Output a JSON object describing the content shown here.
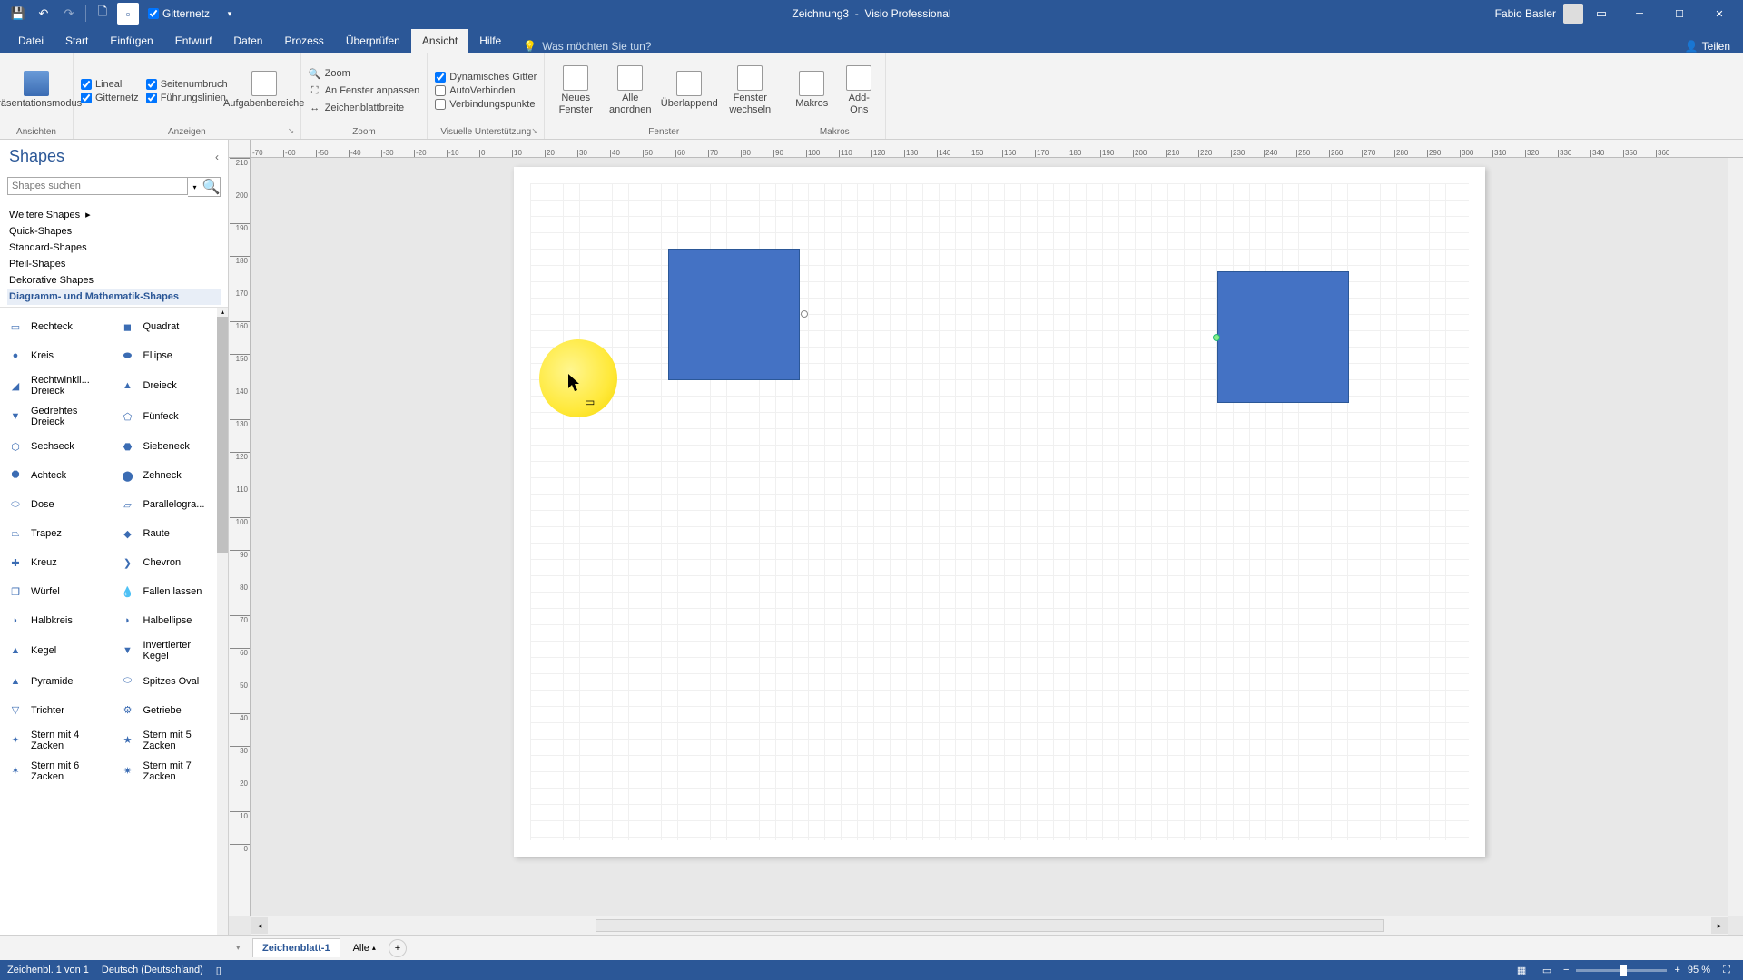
{
  "app": {
    "doc_title": "Zeichnung3",
    "app_name": "Visio Professional",
    "user_name": "Fabio Basler",
    "qat_check_label": "Gitternetz",
    "share_label": "Teilen"
  },
  "tabs": {
    "datei": "Datei",
    "start": "Start",
    "einfuegen": "Einfügen",
    "entwurf": "Entwurf",
    "daten": "Daten",
    "prozess": "Prozess",
    "ueberpruefen": "Überprüfen",
    "ansicht": "Ansicht",
    "hilfe": "Hilfe",
    "tellme": "Was möchten Sie tun?"
  },
  "ribbon": {
    "ansichten": {
      "label": "Ansichten",
      "praesentationsmodus": "Präsentationsmodus"
    },
    "anzeigen": {
      "label": "Anzeigen",
      "lineal": "Lineal",
      "gitternetz": "Gitternetz",
      "seitenumbruch": "Seitenumbruch",
      "fuehrungslinien": "Führungslinien",
      "aufgabenbereiche": "Aufgabenbereiche"
    },
    "zoom": {
      "label": "Zoom",
      "zoom": "Zoom",
      "fenster_anpassen": "An Fenster anpassen",
      "zeichenblattbreite": "Zeichenblattbreite"
    },
    "visuelle": {
      "label": "Visuelle Unterstützung",
      "dynamisches_gitter": "Dynamisches Gitter",
      "autoverbinden": "AutoVerbinden",
      "verbindungspunkte": "Verbindungspunkte"
    },
    "fenster": {
      "label": "Fenster",
      "neues_fenster": "Neues\nFenster",
      "alle_anordnen": "Alle\nanordnen",
      "ueberlappend": "Überlappend",
      "fenster_wechseln": "Fenster\nwechseln"
    },
    "makros": {
      "label": "Makros",
      "makros": "Makros",
      "addons": "Add-\nOns"
    }
  },
  "shapes_panel": {
    "title": "Shapes",
    "search_placeholder": "Shapes suchen",
    "stencils": {
      "weitere": "Weitere Shapes",
      "quick": "Quick-Shapes",
      "standard": "Standard-Shapes",
      "pfeil": "Pfeil-Shapes",
      "dekorative": "Dekorative Shapes",
      "diagramm": "Diagramm- und Mathematik-Shapes"
    },
    "shapes": [
      {
        "label": "Rechteck",
        "icon": "rect"
      },
      {
        "label": "Quadrat",
        "icon": "square"
      },
      {
        "label": "Kreis",
        "icon": "circle"
      },
      {
        "label": "Ellipse",
        "icon": "ellipse"
      },
      {
        "label": "Rechtwinkli...\nDreieck",
        "icon": "rtri"
      },
      {
        "label": "Dreieck",
        "icon": "tri"
      },
      {
        "label": "Gedrehtes\nDreieck",
        "icon": "rottri"
      },
      {
        "label": "Fünfeck",
        "icon": "pent"
      },
      {
        "label": "Sechseck",
        "icon": "hex"
      },
      {
        "label": "Siebeneck",
        "icon": "hept"
      },
      {
        "label": "Achteck",
        "icon": "oct"
      },
      {
        "label": "Zehneck",
        "icon": "dec"
      },
      {
        "label": "Dose",
        "icon": "can"
      },
      {
        "label": "Parallelogra...",
        "icon": "para"
      },
      {
        "label": "Trapez",
        "icon": "trap"
      },
      {
        "label": "Raute",
        "icon": "diamond"
      },
      {
        "label": "Kreuz",
        "icon": "cross"
      },
      {
        "label": "Chevron",
        "icon": "chevron"
      },
      {
        "label": "Würfel",
        "icon": "cube"
      },
      {
        "label": "Fallen lassen",
        "icon": "drop"
      },
      {
        "label": "Halbkreis",
        "icon": "semicircle"
      },
      {
        "label": "Halbellipse",
        "icon": "semiellipse"
      },
      {
        "label": "Kegel",
        "icon": "cone"
      },
      {
        "label": "Invertierter\nKegel",
        "icon": "invcone"
      },
      {
        "label": "Pyramide",
        "icon": "pyramid"
      },
      {
        "label": "Spitzes Oval",
        "icon": "pointedoval"
      },
      {
        "label": "Trichter",
        "icon": "funnel"
      },
      {
        "label": "Getriebe",
        "icon": "gear"
      },
      {
        "label": "Stern mit 4\nZacken",
        "icon": "star4"
      },
      {
        "label": "Stern mit 5\nZacken",
        "icon": "star5"
      },
      {
        "label": "Stern mit 6\nZacken",
        "icon": "star6"
      },
      {
        "label": "Stern mit 7\nZacken",
        "icon": "star7"
      }
    ]
  },
  "ruler_h": [
    -70,
    -60,
    -50,
    -40,
    -30,
    -20,
    -10,
    0,
    10,
    20,
    30,
    40,
    50,
    60,
    70,
    80,
    90,
    100,
    110,
    120,
    130,
    140,
    150,
    160,
    170,
    180,
    190,
    200,
    210,
    220,
    230,
    240,
    250,
    260,
    270,
    280,
    290,
    300,
    310,
    320,
    330,
    340,
    350,
    360
  ],
  "ruler_v": [
    210,
    200,
    190,
    180,
    170,
    160,
    150,
    140,
    130,
    120,
    110,
    100,
    90,
    80,
    70,
    60,
    50,
    40,
    30,
    20,
    10,
    0
  ],
  "pages": {
    "tab1": "Zeichenblatt-1",
    "all": "Alle"
  },
  "status": {
    "page_info": "Zeichenbl. 1 von 1",
    "language": "Deutsch (Deutschland)",
    "zoom": "95 %"
  }
}
